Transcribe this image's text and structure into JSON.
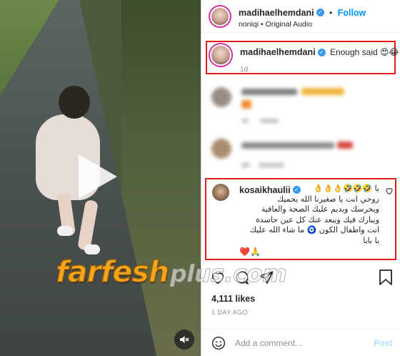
{
  "post": {
    "author": "madihaelhemdani",
    "follow_label": "Follow",
    "audio": "noniqi",
    "audio_sep": "•",
    "audio_label": "Original Audio"
  },
  "caption": {
    "username": "madihaelhemdani",
    "text": "Enough said",
    "emojis": "😍😂",
    "time": "1d"
  },
  "highlighted_comment": {
    "username": "kosaikhaulii",
    "lines": [
      "يا 🤣🤣🤣👌👌👌",
      "روحي انت يا صغيرنا الله يحميك",
      "ويحرسك ويديم عليك الصحة والعافية",
      "ويبارك فيك ويبعد عنك كل عين حاسدة",
      "انت واطفال الكون 🧿 ما شاء الله عليك",
      "يا بابا"
    ],
    "reaction": "❤️🙏"
  },
  "engagement": {
    "likes": "4,111 likes",
    "date": "1 DAY AGO"
  },
  "composer": {
    "placeholder": "Add a comment...",
    "post_label": "Post"
  },
  "watermark": {
    "part1": "farfesh",
    "part2": "plus.com"
  },
  "icons": {
    "verified": "verified-badge-icon",
    "play": "play-icon",
    "mute": "muted-speaker-icon",
    "like": "heart-icon",
    "comment": "comment-bubble-icon",
    "share": "paper-plane-icon",
    "save": "bookmark-icon",
    "emoji": "smiley-face-icon"
  },
  "colors": {
    "accent": "#0095f6",
    "highlight_border": "#e11a1a",
    "verified": "#3897f0",
    "watermark": "#f4a51c"
  }
}
